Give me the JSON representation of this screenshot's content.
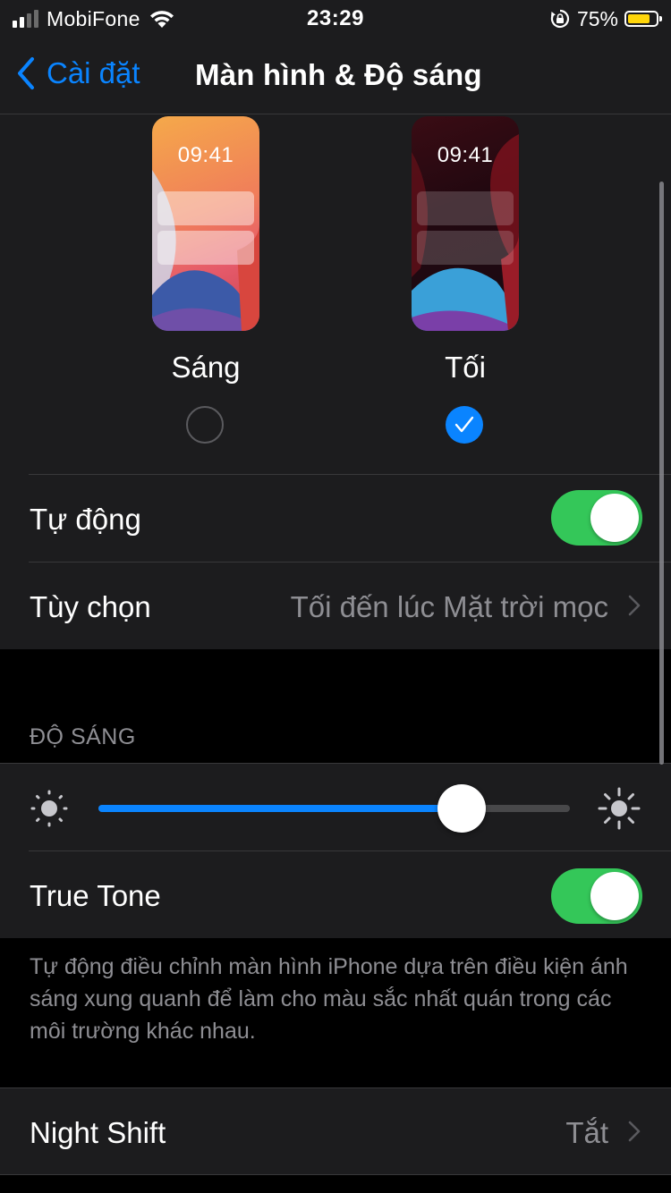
{
  "status_bar": {
    "carrier": "MobiFone",
    "time": "23:29",
    "battery_percent": "75%",
    "battery_color": "#ffd60a",
    "icons": [
      "cellular-signal-icon",
      "wifi-icon",
      "orientation-lock-icon",
      "battery-icon"
    ]
  },
  "nav": {
    "back_label": "Cài đặt",
    "title": "Màn hình & Độ sáng"
  },
  "appearance": {
    "light": {
      "preview_time": "09:41",
      "label": "Sáng",
      "selected": false
    },
    "dark": {
      "preview_time": "09:41",
      "label": "Tối",
      "selected": true
    }
  },
  "auto_row": {
    "label": "Tự động",
    "toggle_on": true
  },
  "options_row": {
    "label": "Tùy chọn",
    "value": "Tối đến lúc Mặt trời mọc"
  },
  "brightness_section": {
    "header": "ĐỘ SÁNG",
    "level": 0.77
  },
  "true_tone": {
    "label": "True Tone",
    "toggle_on": true,
    "footer": "Tự động điều chỉnh màn hình iPhone dựa trên điều kiện ánh sáng xung quanh để làm cho màu sắc nhất quán trong các môi trường khác nhau."
  },
  "night_shift": {
    "label": "Night Shift",
    "value": "Tắt"
  },
  "colors": {
    "accent": "#0a84ff",
    "toggle_on": "#34c759",
    "group_bg": "#1c1c1e",
    "secondary_text": "#8e8e93"
  }
}
